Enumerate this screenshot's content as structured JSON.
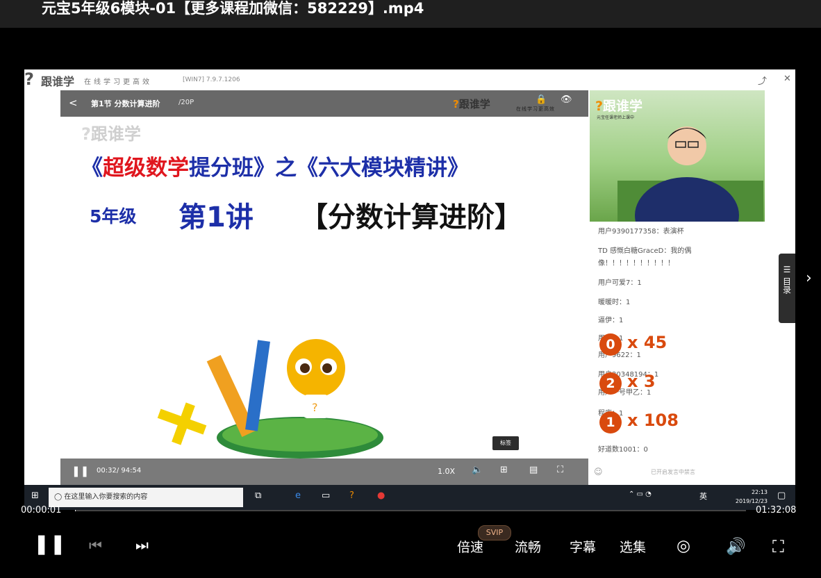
{
  "window": {
    "title": "元宝5年级6模块-01【更多课程加微信：582229】.mp4"
  },
  "app": {
    "logo": "跟谁学",
    "slogan": "在线学习更高效",
    "version": "[WIN7] 7.9.7.1206"
  },
  "slide": {
    "lesson_label": "第1节 分数计算进阶",
    "page": "/20P",
    "brand": "跟谁学",
    "brand_sub": "在线学习更高效",
    "watermark": "跟谁学",
    "course_title_red": "超级数学",
    "course_title_pre": "《",
    "course_title_mid": "提分班》之《六大模块精讲》",
    "grade": "5年级",
    "lecture": "第1讲",
    "topic": "【分数计算进阶】"
  },
  "teacher_panel": {
    "logo": "跟谁学",
    "sub": "元宝任课老师上课中"
  },
  "chat": [
    {
      "text": "用户9390177358：表演杯"
    },
    {
      "text": "TD 感慨白糖GraceD：我的偶"
    },
    {
      "text": "像！！！！！！！！！！"
    },
    {
      "text": "用户可爱7：1"
    },
    {
      "text": "暖暖时：1"
    },
    {
      "text": "逼伊：1"
    },
    {
      "text": "用户：1"
    },
    {
      "text": "用户9622：1"
    },
    {
      "text": "用户30348194：1"
    },
    {
      "text": "用户一号甲乙：1"
    },
    {
      "text": "程序：1"
    },
    {
      "text": "好道数1001：0"
    }
  ],
  "gifts": [
    {
      "number": "0",
      "multiplier": "x 45"
    },
    {
      "number": "2",
      "multiplier": "x 3"
    },
    {
      "number": "1",
      "multiplier": "x 108"
    }
  ],
  "chat_input_placeholder": "已开启发言中禁言",
  "side_tab": {
    "label": "目录"
  },
  "slide_controls": {
    "time": "00:32/ 94:54",
    "speed": "1.0X",
    "tooltip": "标签"
  },
  "taskbar": {
    "search_placeholder": "在这里输入你要搜索的内容",
    "ime": "英",
    "time": "22:13",
    "date": "2019/12/23"
  },
  "player": {
    "current_time": "00:00:01",
    "duration": "01:32:08",
    "progress": 0.0002,
    "speed_label": "倍速",
    "svip_badge": "SVIP",
    "quality_label": "流畅",
    "subtitle_label": "字幕",
    "episodes_label": "选集"
  }
}
